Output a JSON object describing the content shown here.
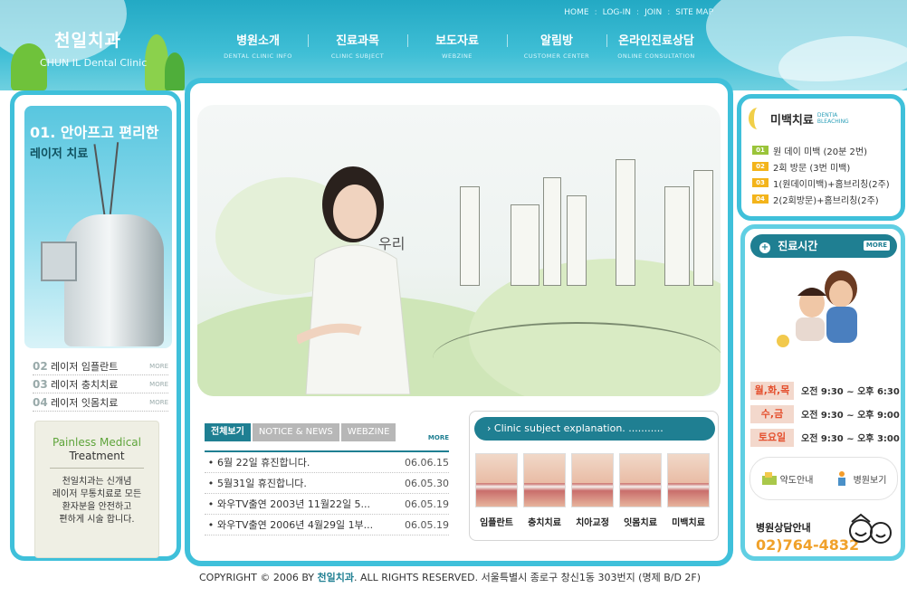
{
  "utility_nav": [
    "HOME",
    "LOG-IN",
    "JOIN",
    "SITE MAP"
  ],
  "logo": {
    "korean": "천일치과",
    "english": "CHUN IL Dental Clinic"
  },
  "main_nav": [
    {
      "label": "병원소개",
      "sub": "DENTAL CLINIC INFO"
    },
    {
      "label": "진료과목",
      "sub": "CLINIC SUBJECT"
    },
    {
      "label": "보도자료",
      "sub": "WEBZINE"
    },
    {
      "label": "알림방",
      "sub": "CUSTOMER CENTER"
    },
    {
      "label": "온라인진료상담",
      "sub": "ONLINE CONSULTATION"
    }
  ],
  "laser_banner": {
    "title": "01. 안아프고 편리한",
    "subtitle": "레이저 치료"
  },
  "laser_menu": [
    {
      "num": "02",
      "label": "레이저 임플란트",
      "more": "MORE"
    },
    {
      "num": "03",
      "label": "레이저 충치치료",
      "more": "MORE"
    },
    {
      "num": "04",
      "label": "레이저 잇몸치료",
      "more": "MORE"
    }
  ],
  "painless": {
    "title1": "Painless Medical",
    "title2": "Treatment",
    "desc": [
      "천일치과는 신개념",
      "레이저 무통치료로 모든",
      "환자분을 안전하고",
      "편하게 시술 합니다."
    ]
  },
  "hero": {
    "text": "우리"
  },
  "news": {
    "tabs": [
      "전체보기",
      "NOTICE & NEWS",
      "WEBZINE"
    ],
    "more": "MORE",
    "items": [
      {
        "title": "6월 22일 휴진합니다.",
        "date": "06.06.15"
      },
      {
        "title": "5월31일 휴진합니다.",
        "date": "06.05.30"
      },
      {
        "title": "와우TV출연 2003년 11월22일 5...",
        "date": "06.05.19"
      },
      {
        "title": "와우TV출연 2006년 4월29일 1부...",
        "date": "06.05.19"
      }
    ]
  },
  "subjects": {
    "header": "Clinic subject explanation.",
    "items": [
      "임플란트",
      "충치치료",
      "치아교정",
      "잇몸치료",
      "미백치료"
    ]
  },
  "whitening": {
    "title": "미백치료",
    "en1": "DENTIA",
    "en2": "BLEACHING",
    "items": [
      {
        "num": "01",
        "label": "원 데이 미백 (20분 2번)"
      },
      {
        "num": "02",
        "label": "2회 방문 (3번 미백)"
      },
      {
        "num": "03",
        "label": "1(원데이미백)+홈브리칭(2주)"
      },
      {
        "num": "04",
        "label": "2(2회방문)+홈브리칭(2주)"
      }
    ]
  },
  "hours": {
    "title": "진료시간",
    "more": "MORE",
    "rows": [
      {
        "day": "월,화,목",
        "time": "오전 9:30 ~ 오후 6:30"
      },
      {
        "day": "수,금",
        "time": "오전 9:30 ~ 오후 9:00"
      },
      {
        "day": "토요일",
        "time": "오전 9:30 ~ 오후 3:00"
      }
    ]
  },
  "quick": {
    "map": "약도안내",
    "hospital": "병원보기"
  },
  "contact": {
    "label": "병원상담안내",
    "tel": "02)764-4832"
  },
  "footer": {
    "prefix": "COPYRIGHT © 2006 BY ",
    "brand": "천일치과",
    "suffix": ". ALL RIGHTS RESERVED.   서울특별시 종로구 창신1동 303번지 (명제 B/D 2F)"
  }
}
